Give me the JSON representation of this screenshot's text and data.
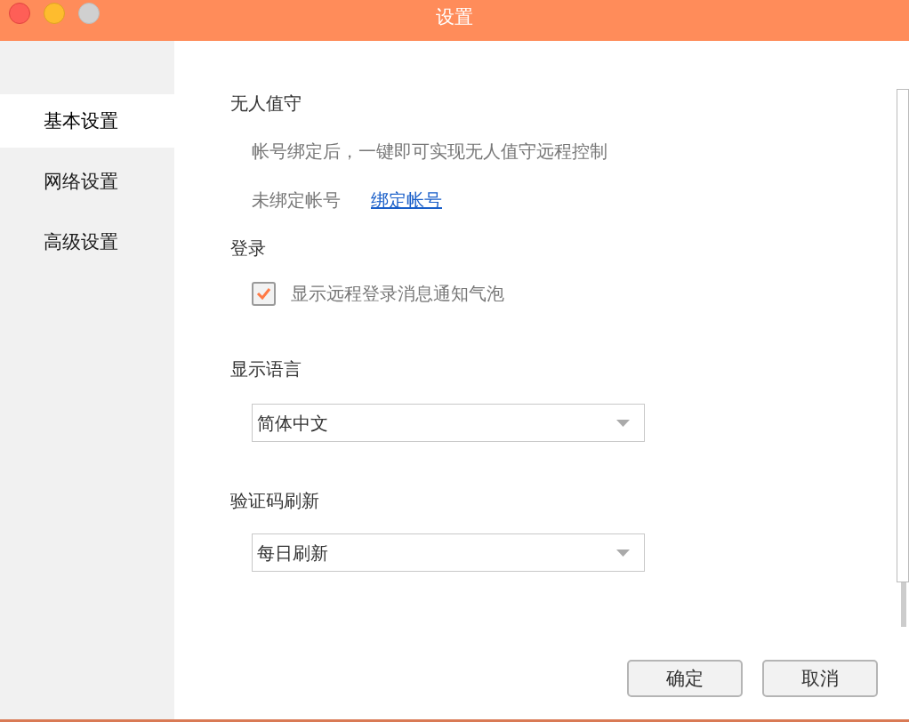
{
  "window": {
    "title": "设置"
  },
  "sidebar": {
    "items": [
      {
        "label": "基本设置",
        "selected": true
      },
      {
        "label": "网络设置",
        "selected": false
      },
      {
        "label": "高级设置",
        "selected": false
      }
    ]
  },
  "unattended": {
    "heading": "无人值守",
    "description": "帐号绑定后，一键即可实现无人值守远程控制",
    "status": "未绑定帐号",
    "link": "绑定帐号"
  },
  "login": {
    "heading": "登录",
    "checkbox": {
      "label": "显示远程登录消息通知气泡",
      "checked": true
    }
  },
  "language": {
    "heading": "显示语言",
    "value": "简体中文"
  },
  "captcha": {
    "heading": "验证码刷新",
    "value": "每日刷新"
  },
  "buttons": [
    "确定",
    "取消"
  ]
}
